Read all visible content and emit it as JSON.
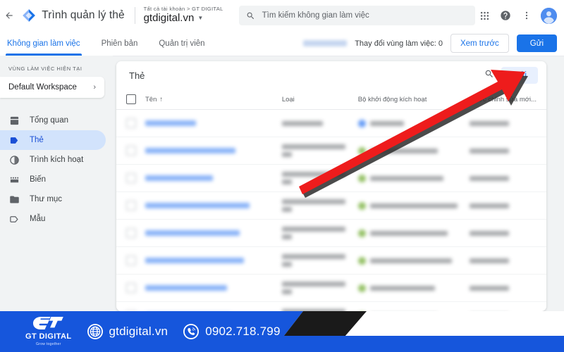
{
  "topbar": {
    "back_icon": "back-arrow-icon",
    "logo_icon": "google-tag-manager-logo",
    "app_title": "Trình quản lý thẻ",
    "account_breadcrumb": "Tất cả tài khoản > GT DIGITAL",
    "account_name": "gtdigital.vn",
    "search_placeholder": "Tìm kiếm không gian làm việc",
    "search_icon": "search-icon",
    "apps_icon": "apps-grid-icon",
    "help_icon": "help-icon",
    "more_icon": "more-vertical-icon",
    "avatar_icon": "user-avatar"
  },
  "tabs": {
    "items": [
      {
        "label": "Không gian làm việc",
        "active": true
      },
      {
        "label": "Phiên bản",
        "active": false
      },
      {
        "label": "Quản trị viên",
        "active": false
      }
    ],
    "changes_label": "Thay đổi vùng làm việc: 0",
    "preview_label": "Xem trước",
    "submit_label": "Gửi"
  },
  "sidebar": {
    "section_label": "VÙNG LÀM VIỆC HIỆN TẠI",
    "workspace_name": "Default Workspace",
    "workspace_chevron": "chevron-right-icon",
    "items": [
      {
        "label": "Tổng quan",
        "icon": "overview-icon",
        "active": false
      },
      {
        "label": "Thẻ",
        "icon": "tag-icon",
        "active": true
      },
      {
        "label": "Trình kích hoạt",
        "icon": "trigger-icon",
        "active": false
      },
      {
        "label": "Biến",
        "icon": "variables-icon",
        "active": false
      },
      {
        "label": "Thư mục",
        "icon": "folder-icon",
        "active": false
      },
      {
        "label": "Mẫu",
        "icon": "template-icon",
        "active": false
      }
    ]
  },
  "card": {
    "title": "Thẻ",
    "search_icon": "search-icon",
    "new_button_label": "Mới",
    "columns": [
      {
        "label": "Tên",
        "sort_icon": "sort-ascending-arrow"
      },
      {
        "label": "Loại"
      },
      {
        "label": "Bộ khởi động kích hoạt"
      },
      {
        "label": "Được chỉnh sửa mới..."
      }
    ],
    "rows": [
      {
        "name_w": 72,
        "type_w": 58,
        "type_w2": 0,
        "trig_w": 48,
        "dot": "blue",
        "mod_w": 56
      },
      {
        "name_w": 128,
        "type_w": 90,
        "type_w2": 14,
        "trig_w": 96,
        "dot": "green",
        "mod_w": 56
      },
      {
        "name_w": 96,
        "type_w": 90,
        "type_w2": 14,
        "trig_w": 104,
        "dot": "green",
        "mod_w": 56
      },
      {
        "name_w": 148,
        "type_w": 90,
        "type_w2": 14,
        "trig_w": 124,
        "dot": "green",
        "mod_w": 56
      },
      {
        "name_w": 134,
        "type_w": 90,
        "type_w2": 14,
        "trig_w": 110,
        "dot": "green",
        "mod_w": 56
      },
      {
        "name_w": 140,
        "type_w": 90,
        "type_w2": 14,
        "trig_w": 116,
        "dot": "green",
        "mod_w": 56
      },
      {
        "name_w": 116,
        "type_w": 90,
        "type_w2": 14,
        "trig_w": 92,
        "dot": "green",
        "mod_w": 56
      },
      {
        "name_w": 122,
        "type_w": 90,
        "type_w2": 14,
        "trig_w": 96,
        "dot": "green",
        "mod_w": 56
      },
      {
        "name_w": 118,
        "type_w": 90,
        "type_w2": 14,
        "trig_w": 74,
        "dot": "green",
        "mod_w": 56
      }
    ]
  },
  "annotation": {
    "arrow_icon": "red-arrow-pointer",
    "arrow_color": "#ee1c1c"
  },
  "banner": {
    "brand_name": "GT DIGITAL",
    "brand_tagline": "Grow together",
    "brand_mark": "gt-monogram-icon",
    "website_icon": "globe-icon",
    "website": "gtdigital.vn",
    "phone_icon": "phone-icon",
    "phone": "0902.718.799",
    "bg_color": "#1656dc",
    "stripe_color": "#1a1a1a"
  }
}
